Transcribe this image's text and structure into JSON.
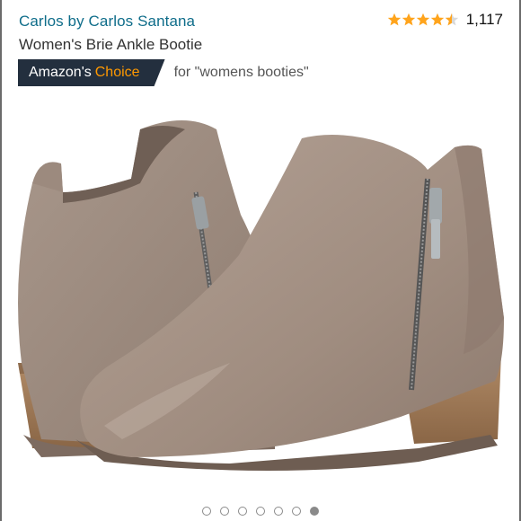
{
  "product": {
    "brand": "Carlos by Carlos Santana",
    "title": "Women's Brie Ankle Bootie",
    "rating_count": "1,117",
    "rating_value": 4.5
  },
  "badge": {
    "label_main": "Amazon's",
    "label_accent": "Choice",
    "for_text": "for \"womens booties\""
  },
  "colors": {
    "brand_link": "#0f6d8a",
    "star": "#ffa41c",
    "badge_bg": "#232f3e",
    "badge_accent": "#ff9900"
  },
  "icons": {
    "rating": "star-icon"
  },
  "carousel": {
    "total": 7,
    "active_index": 6
  }
}
